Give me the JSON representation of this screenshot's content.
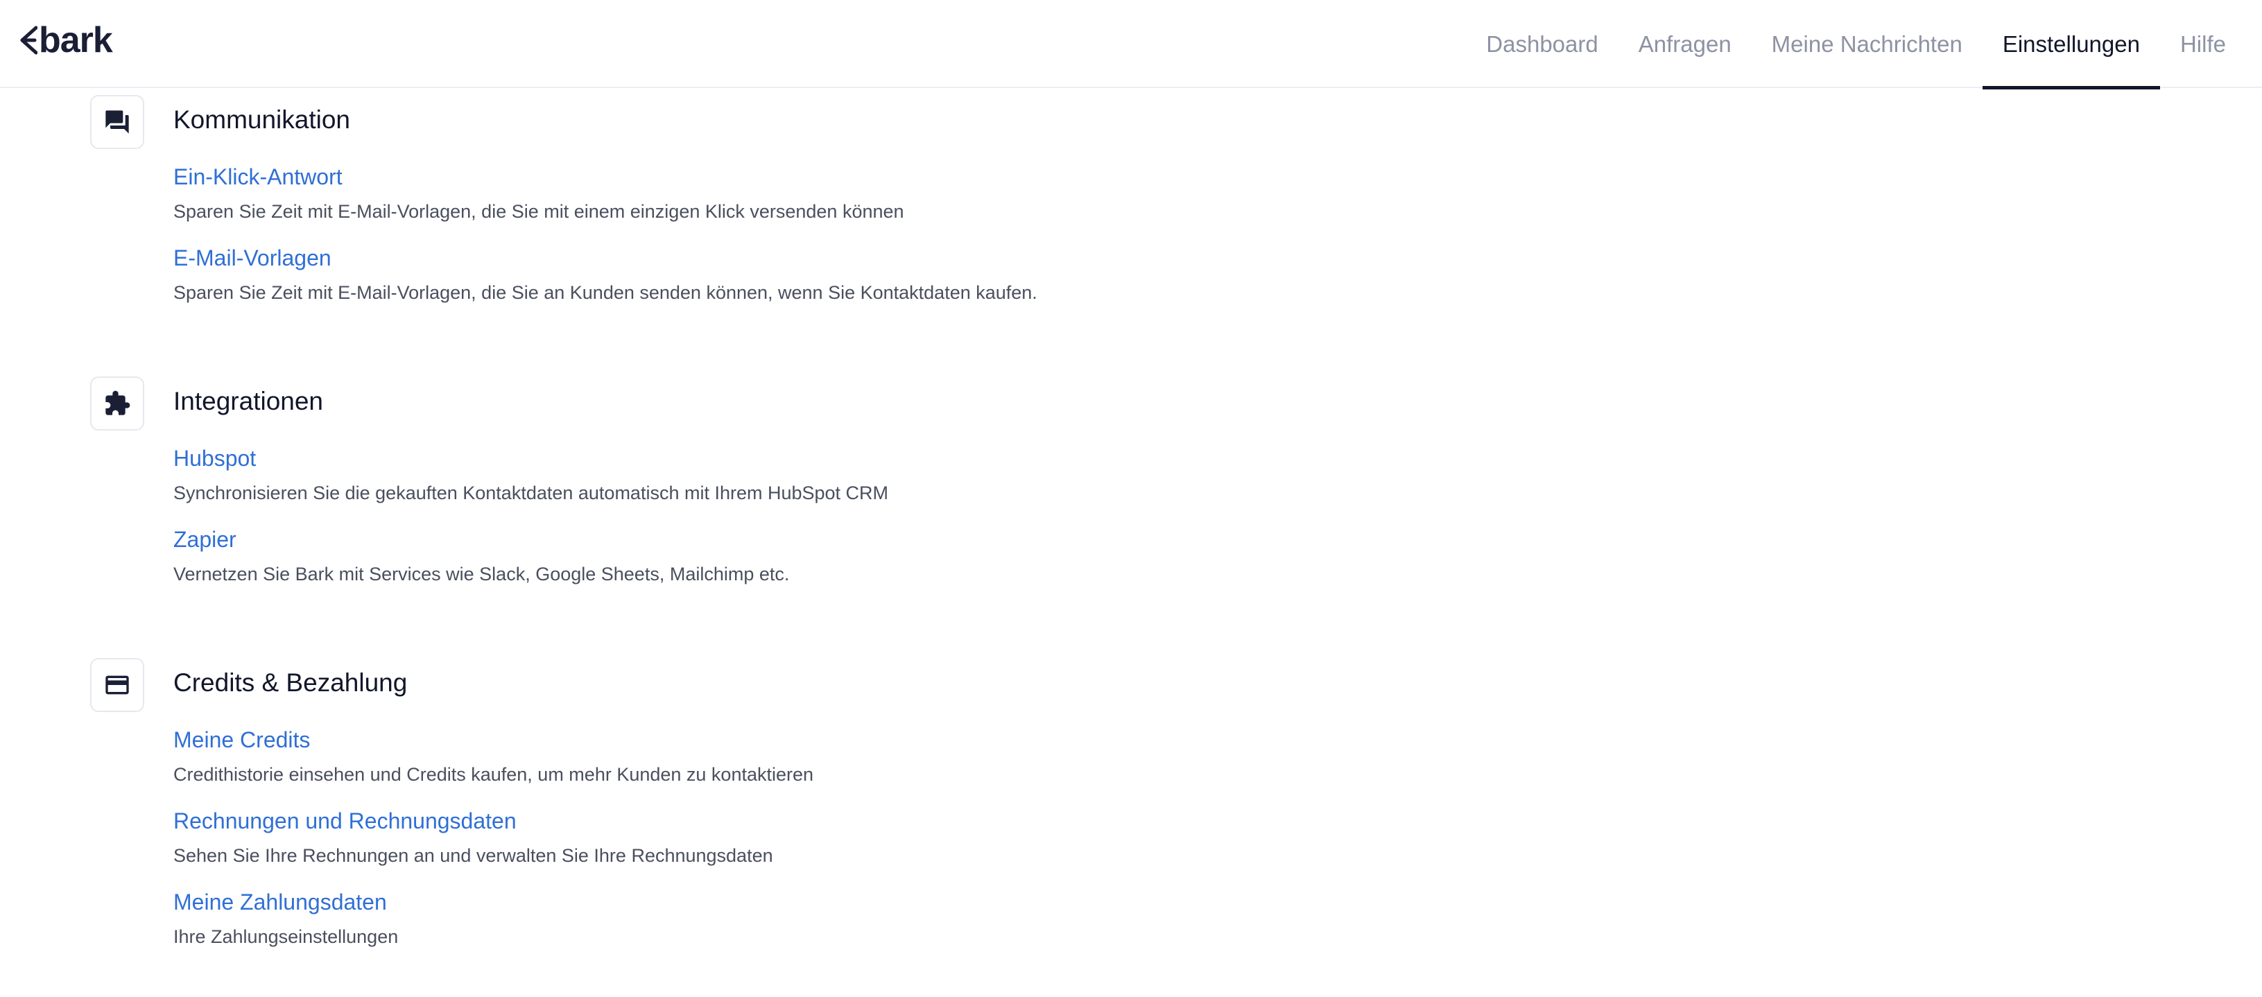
{
  "brand": {
    "name": "bark"
  },
  "nav": {
    "items": [
      {
        "label": "Dashboard",
        "active": false
      },
      {
        "label": "Anfragen",
        "active": false
      },
      {
        "label": "Meine Nachrichten",
        "active": false
      },
      {
        "label": "Einstellungen",
        "active": true
      },
      {
        "label": "Hilfe",
        "active": false
      }
    ]
  },
  "sections": [
    {
      "title": "Kommunikation",
      "icon": "chat-bubbles-icon",
      "items": [
        {
          "label": "Ein-Klick-Antwort",
          "description": "Sparen Sie Zeit mit E-Mail-Vorlagen, die Sie mit einem einzigen Klick versenden können"
        },
        {
          "label": "E-Mail-Vorlagen",
          "description": "Sparen Sie Zeit mit E-Mail-Vorlagen, die Sie an Kunden senden können, wenn Sie Kontaktdaten kaufen."
        }
      ]
    },
    {
      "title": "Integrationen",
      "icon": "puzzle-piece-icon",
      "items": [
        {
          "label": "Hubspot",
          "description": "Synchronisieren Sie die gekauften Kontaktdaten automatisch mit Ihrem HubSpot CRM"
        },
        {
          "label": "Zapier",
          "description": "Vernetzen Sie Bark mit Services wie Slack, Google Sheets, Mailchimp etc."
        }
      ]
    },
    {
      "title": "Credits & Bezahlung",
      "icon": "credit-card-icon",
      "items": [
        {
          "label": "Meine Credits",
          "description": "Credithistorie einsehen und Credits kaufen, um mehr Kunden zu kontaktieren"
        },
        {
          "label": "Rechnungen und Rechnungsdaten",
          "description": "Sehen Sie Ihre Rechnungen an und verwalten Sie Ihre Rechnungsdaten"
        },
        {
          "label": "Meine Zahlungsdaten",
          "description": "Ihre Zahlungseinstellungen"
        }
      ]
    }
  ],
  "colors": {
    "link": "#2f6fd6",
    "text_dark": "#12162a",
    "text_muted": "#8d92a3",
    "description": "#4a4f5e"
  }
}
